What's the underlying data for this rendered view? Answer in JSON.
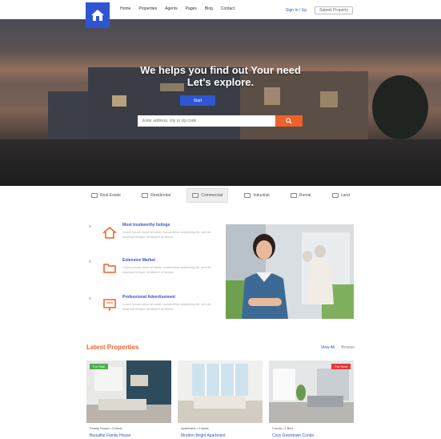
{
  "header": {
    "nav": [
      "Home",
      "Properties",
      "Agents",
      "Pages",
      "Blog",
      "Contact"
    ],
    "login_link": "Sign In / Up",
    "submit_button": "Submit Property"
  },
  "hero": {
    "title_line1": "We helps you find out Your need",
    "title_line2": "Let's explore.",
    "cta_label": "Start",
    "search_placeholder": "Enter address, city or zip code"
  },
  "tabs": [
    "Real Estate",
    "Residential",
    "Commercial",
    "Industrial",
    "Rental",
    "Land"
  ],
  "features": [
    {
      "title": "Most trustworthy listings",
      "desc": "Lorem ipsum dolor sit amet, consectetur adipiscing elit, sed do eiusmod tempor incididunt ut labore."
    },
    {
      "title": "Extensive Market",
      "desc": "Lorem ipsum dolor sit amet, consectetur adipiscing elit, sed do eiusmod tempor incididunt ut labore."
    },
    {
      "title": "Professional Advertisement",
      "desc": "Lorem ipsum dolor sit amet, consectetur adipiscing elit, sed do eiusmod tempor incididunt ut labore."
    }
  ],
  "latest": {
    "title": "Latest Properties",
    "link_all": "View All",
    "link_more": "Browse",
    "cards": [
      {
        "badge": "For Sale",
        "badge_color": "#4caf50",
        "caption": "Family House • 3 Beds",
        "title": "Beautiful Family House"
      },
      {
        "badge": "",
        "badge_color": "#4caf50",
        "caption": "Apartment • 2 Beds",
        "title": "Modern Bright Apartment"
      },
      {
        "badge": "For Rent",
        "badge_color": "#e53935",
        "caption": "Condo • 1 Bed",
        "title": "Cozy Downtown Condo"
      }
    ]
  },
  "colors": {
    "brand": "#2f55d4",
    "accent": "#f0612a"
  }
}
